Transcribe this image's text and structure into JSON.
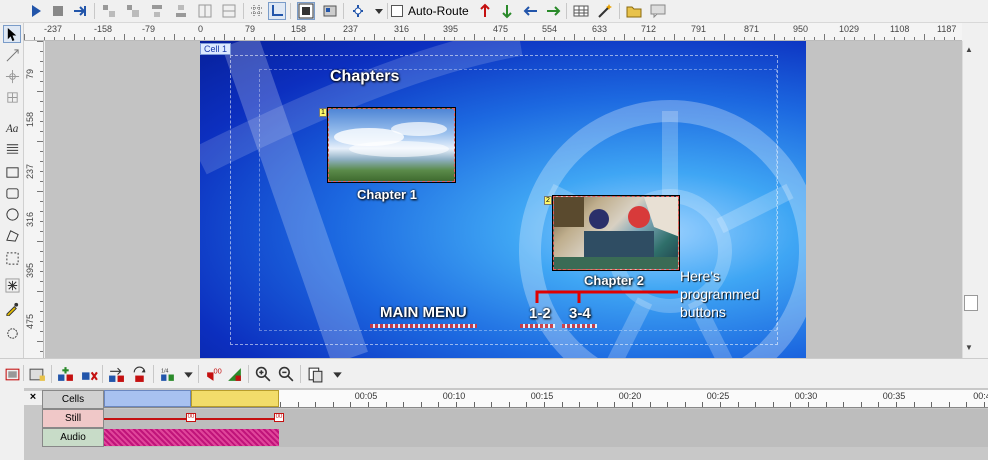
{
  "toolbar": {
    "autoroute_label": "Auto-Route",
    "autoroute_checked": false,
    "icons": [
      "play-icon",
      "stop-icon",
      "route-icon",
      "align-icon",
      "align-icon",
      "align-icon",
      "align-icon",
      "align-icon",
      "align-icon",
      "grid-icon",
      "snap-icon",
      "safe-area-icon",
      "still-icon",
      "anchor-icon",
      "dropdown-icon",
      "autoroute-checkbox",
      "route-up-icon",
      "route-down-icon",
      "route-left-icon",
      "route-right-icon",
      "table-icon",
      "wand-icon",
      "folder-icon",
      "chat-icon"
    ]
  },
  "palette": {
    "tools": [
      "pointer-icon",
      "route-tool-icon",
      "connect-icon",
      "grid-tool-icon",
      "text-icon",
      "lines-icon",
      "rectangle-icon",
      "rounded-rect-icon",
      "ellipse-icon",
      "polygon-icon",
      "crop-icon",
      "asterisk-icon",
      "eyedropper-icon",
      "circle-icon"
    ]
  },
  "hruler": {
    "labels": [
      "-237",
      "-158",
      "-79",
      "0",
      "79",
      "158",
      "237",
      "316",
      "395",
      "475",
      "554",
      "633",
      "712",
      "791",
      "871",
      "950",
      "1029",
      "1108",
      "1187"
    ]
  },
  "vruler": {
    "labels": [
      "79",
      "158",
      "237",
      "316",
      "395",
      "475"
    ]
  },
  "canvas": {
    "cell_tag": "Cell 1",
    "title": "Chapters",
    "chapter1_label": "Chapter 1",
    "chapter2_label": "Chapter 2",
    "main_menu_label": "MAIN MENU",
    "button_1_2": "1-2",
    "button_3_4": "3-4",
    "annotation_lines": [
      "Here's",
      "programmed",
      "buttons"
    ],
    "annotation_color": "#e00000"
  },
  "bottom_toolbar": {
    "icons": [
      "cell-icon",
      "add-cell-icon",
      "remove-cell-icon",
      "move-icon",
      "swap-icon",
      "scale-icon",
      "dropdown-icon",
      "mute-icon",
      "export-icon",
      "zoom-in-icon",
      "zoom-out-icon",
      "paste-icon",
      "dropdown-icon"
    ]
  },
  "timeline": {
    "tracks": [
      "Cells",
      "Still",
      "Audio"
    ],
    "ticks": [
      "00:05",
      "00:10",
      "00:15",
      "00:20",
      "00:25",
      "00:30",
      "00:35",
      "00:4"
    ],
    "cell_colors": [
      "#a8c1f0",
      "#f2dc6a"
    ],
    "still_color": "#c41010",
    "audio_color": "#c0147a"
  }
}
